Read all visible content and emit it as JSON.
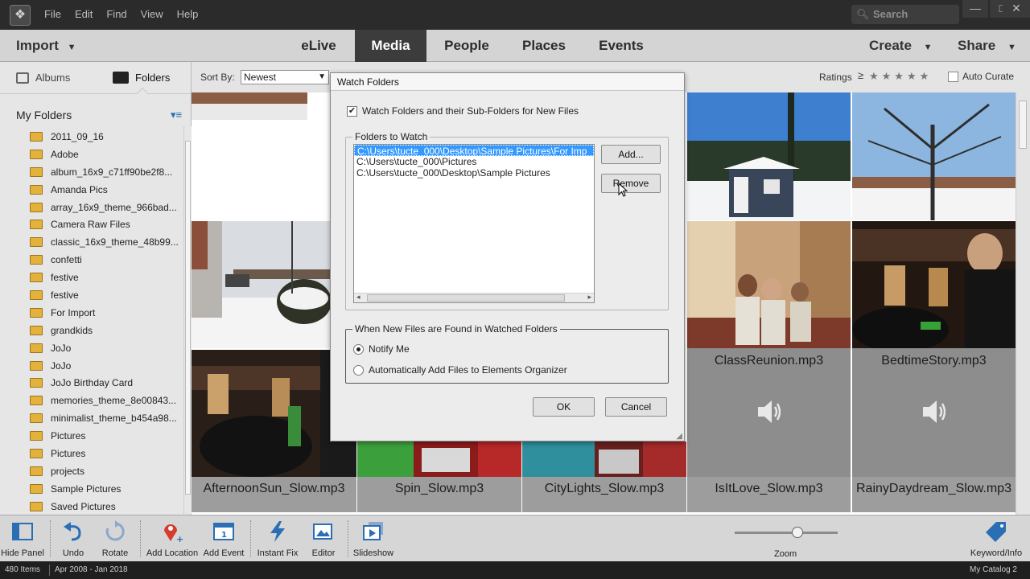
{
  "menu": [
    "File",
    "Edit",
    "Find",
    "View",
    "Help"
  ],
  "search": {
    "placeholder": "Search"
  },
  "window_controls": [
    "—",
    "□",
    "✕"
  ],
  "nav": {
    "import_label": "Import",
    "tabs": [
      "eLive",
      "Media",
      "People",
      "Places",
      "Events"
    ],
    "active_tab": "Media",
    "create_label": "Create",
    "share_label": "Share"
  },
  "left_panel": {
    "albums_tab": "Albums",
    "folders_tab": "Folders",
    "section_title": "My Folders",
    "folders": [
      "2011_09_16",
      "Adobe",
      "album_16x9_c71ff90be2f8...",
      "Amanda Pics",
      "array_16x9_theme_966bad...",
      "Camera Raw Files",
      "classic_16x9_theme_48b99...",
      "confetti",
      "festive",
      "festive",
      "For Import",
      "grandkids",
      "JoJo",
      "JoJo",
      "JoJo Birthday Card",
      "memories_theme_8e00843...",
      "minimalist_theme_b454a98...",
      "Pictures",
      "Pictures",
      "projects",
      "Sample Pictures",
      "Saved Pictures"
    ]
  },
  "sortbar": {
    "sort_label": "Sort By:",
    "sort_value": "Newest",
    "ratings_label": "Ratings",
    "ratings_symbol": "≥",
    "stars": "★★★★★",
    "auto_curate_label": "Auto Curate"
  },
  "media": {
    "audio_tiles": [
      "ClassReunion.mp3",
      "BedtimeStory.mp3"
    ],
    "bottom_captions": [
      "AfternoonSun_Slow.mp3",
      "Spin_Slow.mp3",
      "CityLights_Slow.mp3",
      "IsItLove_Slow.mp3",
      "RainyDaydream_Slow.mp3"
    ]
  },
  "dialog": {
    "title": "Watch Folders",
    "watch_checkbox_label": "Watch Folders and their Sub-Folders for New Files",
    "folders_group_label": "Folders to Watch",
    "folders": [
      "C:\\Users\\tucte_000\\Desktop\\Sample Pictures\\For Imp",
      "C:\\Users\\tucte_000\\Pictures",
      "C:\\Users\\tucte_000\\Desktop\\Sample Pictures"
    ],
    "add_button": "Add...",
    "remove_button": "Remove",
    "found_group_label": "When New Files are Found in Watched Folders",
    "option_notify": "Notify Me",
    "option_auto_add": "Automatically Add Files to Elements Organizer",
    "ok_button": "OK",
    "cancel_button": "Cancel"
  },
  "toolbar": {
    "hide_panel": "Hide Panel",
    "undo": "Undo",
    "rotate": "Rotate",
    "add_location": "Add Location",
    "add_event": "Add Event",
    "instant_fix": "Instant Fix",
    "editor": "Editor",
    "slideshow": "Slideshow",
    "zoom": "Zoom",
    "keyword_info": "Keyword/Info"
  },
  "status": {
    "items": "480 Items",
    "date_range": "Apr 2008 - Jan 2018",
    "catalog": "My Catalog 2"
  },
  "colors": {
    "accent_selection": "#3399ff",
    "active_tab_bg": "#3c3c3c",
    "folder_yellow": "#e4b13a"
  }
}
